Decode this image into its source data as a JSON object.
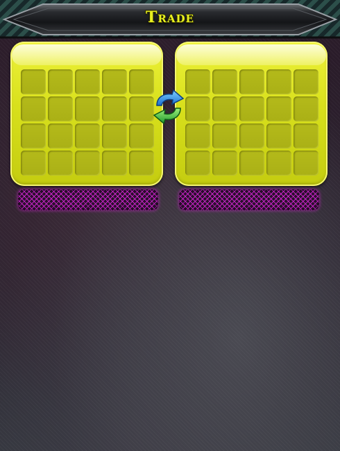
{
  "header": {
    "title": "Trade"
  },
  "colors": {
    "title": "#e8f020",
    "panel": "#d8e01c",
    "slot": "#b0b618",
    "offer_bar": "#dc28dc",
    "header_stripe": "#2c4f4a"
  },
  "trade": {
    "left_inventory": {
      "rows": 4,
      "columns": 5
    },
    "right_inventory": {
      "rows": 4,
      "columns": 5
    },
    "swap_icon": "swap-arrows-icon"
  }
}
